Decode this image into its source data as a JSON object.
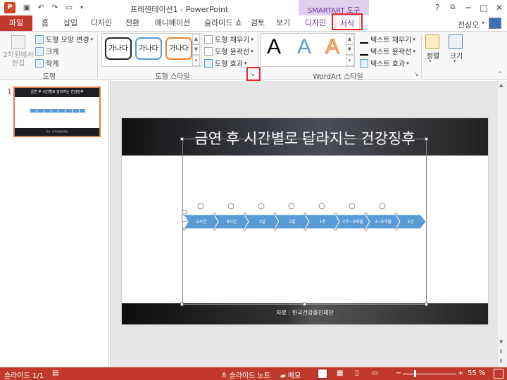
{
  "titlebar": {
    "app_title": "프레젠테이션1 - PowerPoint",
    "contextual_tab_group": "SMARTART 도구",
    "logo_letter": "P",
    "help": "?",
    "restore": "⧉",
    "minimize": "─",
    "maximize": "□",
    "close": "✕"
  },
  "tabs": {
    "file": "파일",
    "home": "홈",
    "insert": "삽입",
    "design": "디자인",
    "transitions": "전환",
    "animations": "애니메이션",
    "slideshow": "슬라이드 쇼",
    "review": "검토",
    "view": "보기",
    "smartart_design": "디자인",
    "format": "서식",
    "user": "전상오"
  },
  "ribbon": {
    "shapes_group": {
      "label": "도형",
      "edit_2d": "2차원에서 편집",
      "change_shape": "도형 모양 변경",
      "larger": "크게",
      "smaller": "작게"
    },
    "shape_styles_group": {
      "label": "도형 스타일",
      "thumbs": [
        "가나다",
        "가나다",
        "가나다"
      ],
      "fill": "도형 채우기",
      "outline": "도형 윤곽선",
      "effects": "도형 효과"
    },
    "wordart_group": {
      "label": "WordArt 스타일",
      "styles": [
        "A",
        "A",
        "A"
      ],
      "text_fill": "텍스트 채우기",
      "text_outline": "텍스트 윤곽선",
      "text_effects": "텍스트 효과"
    },
    "arrange": "정렬",
    "size": "크기"
  },
  "thumbnail": {
    "number": "1",
    "title": "금연 후 시간별로 달라지는 건강징후",
    "footer": "자료 : 한국건강증진재단"
  },
  "slide": {
    "title": "금연 후 시간별로 달라지는 건강징후",
    "source": "자료 : 한국건강증진재단",
    "steps": [
      "2시간",
      "8시간",
      "1일",
      "2일",
      "1주",
      "2주~3개월",
      "3~9개월",
      "1년"
    ]
  },
  "statusbar": {
    "slide_counter": "슬라이드 1/1",
    "notes": "슬라이드 노트",
    "comments": "메모",
    "zoom": "55 %",
    "zoom_minus": "−",
    "zoom_plus": "+"
  },
  "colors": {
    "accent": "#c0392b",
    "contextual": "#7030a0",
    "chevron": "#5b9bd5",
    "highlight": "#e8262b"
  }
}
